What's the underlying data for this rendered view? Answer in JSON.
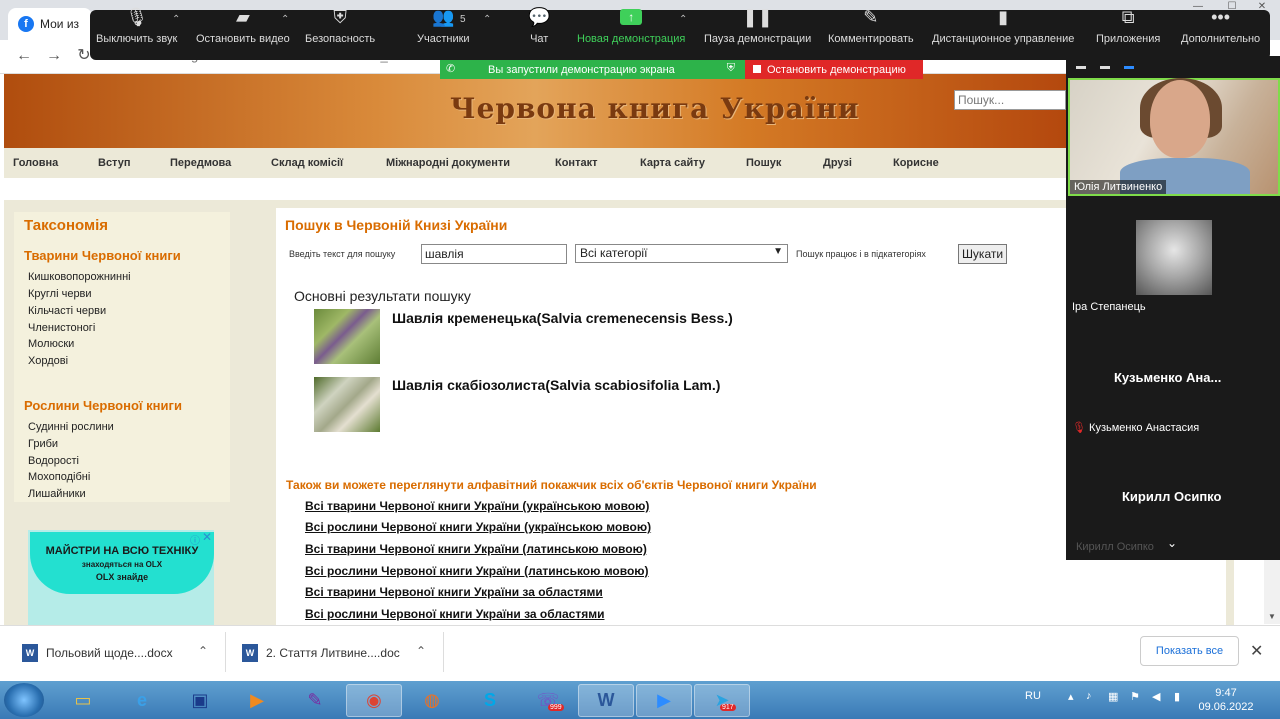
{
  "browser": {
    "tab_title": "Мои из",
    "url": "redbook-ua.org/search.search=шавлія&search_sub"
  },
  "zoom_toolbar": {
    "participants_count": "5",
    "items": [
      {
        "label": "Выключить звук",
        "icon": "microphone-icon"
      },
      {
        "label": "Остановить видео",
        "icon": "video-camera-icon"
      },
      {
        "label": "Безопасность",
        "icon": "shield-icon"
      },
      {
        "label": "Участники",
        "icon": "participants-icon"
      },
      {
        "label": "Чат",
        "icon": "chat-icon"
      },
      {
        "label": "Новая демонстрация",
        "icon": "share-screen-icon"
      },
      {
        "label": "Пауза демонстрации",
        "icon": "pause-icon"
      },
      {
        "label": "Комментировать",
        "icon": "pen-icon"
      },
      {
        "label": "Дистанционное управление",
        "icon": "mouse-icon"
      },
      {
        "label": "Приложения",
        "icon": "apps-icon"
      },
      {
        "label": "Дополнительно",
        "icon": "more-icon"
      }
    ],
    "share_status": "Вы запустили демонстрацию экрана",
    "stop_share": "Остановить демонстрацию",
    "accent_green": "#3fd05a",
    "accent_red": "#e02828"
  },
  "site": {
    "title": "Червона книга України",
    "search_placeholder": "Пошук...",
    "menu": [
      "Головна",
      "Вступ",
      "Передмова",
      "Склад комісії",
      "Міжнародні документи",
      "Контакт",
      "Карта сайту",
      "Пошук",
      "Друзі",
      "Корисне"
    ],
    "accent": "#d96c00"
  },
  "sidebar": {
    "title": "Таксономія",
    "animals_title": "Тварини Червоної книги",
    "animals": [
      "Кишковопорожнинні",
      "Круглі черви",
      "Кільчасті черви",
      "Членистоногі",
      "Молюски",
      "Хордові"
    ],
    "plants_title": "Рослини Червоної книги",
    "plants": [
      "Судинні рослини",
      "Гриби",
      "Водорості",
      "Мохоподібні",
      "Лишайники"
    ]
  },
  "ad": {
    "line1": "МАЙСТРИ НА ВСЮ ТЕХНІКУ",
    "line2": "знаходяться на OLX",
    "line3": "OLX знайде"
  },
  "search": {
    "title": "Пошук в Червоній Книзі України",
    "input_label": "Введіть текст для пошуку",
    "query": "шавлія",
    "category": "Всі категорії",
    "subcat_note": "Пошук працює і в підкатегоріях",
    "button": "Шукати",
    "results_heading": "Основні результати пошуку",
    "results": [
      "Шавлія кременецька(Salvia cremenecensis Bess.)",
      "Шавлія скабіозолиста(Salvia scabiosifolia Lam.)"
    ],
    "also_text": "Також ви можете переглянути алфавітний покажчик всіх об'єктів Червоної книги України",
    "index_links": [
      "Всі тварини Червоної книги України (українською мовою)",
      "Всі рослини Червоної книги України (українською мовою)",
      "Всі тварини Червоної книги України (латинською мовою)",
      "Всі рослини Червоної книги України (латинською мовою)",
      "Всі тварини Червоної книги України за областями",
      "Всі рослини Червоної книги України за областями"
    ]
  },
  "participants": {
    "p1": "Юлія Литвиненко",
    "p2": "Іра Степанець",
    "p3_big": "Кузьменко  Ана...",
    "p3": "Кузьменко Анастасия",
    "p4_big": "Кирилл Осипко",
    "p4": "Кирилл Осипко"
  },
  "downloads": {
    "file1": "Польовий щоде....docx",
    "file2": "2. Стаття Литвине....doc",
    "show_all": "Показать все"
  },
  "taskbar": {
    "lang": "RU",
    "time": "9:47",
    "date": "09.06.2022",
    "viber_badge": "999",
    "telegram_badge": "917"
  }
}
